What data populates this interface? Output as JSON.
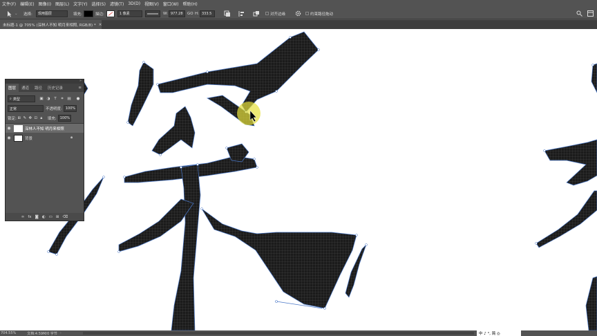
{
  "menu": [
    "文件(F)",
    "编辑(E)",
    "图像(I)",
    "图层(L)",
    "文字(Y)",
    "选择(S)",
    "滤镜(T)",
    "3D(D)",
    "视图(V)",
    "窗口(W)",
    "帮助(H)"
  ],
  "options": {
    "select_label": "选择:",
    "select_value": "现用图层",
    "fill_label": "填充:",
    "stroke_label": "描边:",
    "stroke_width": "1 像素",
    "w_label": "W:",
    "w_value": "977.28",
    "link_label": "GO",
    "h_label": "H:",
    "h_value": "333.5",
    "align_edges_label": "对齐边缘",
    "constrain_label": "约束路径拖动"
  },
  "document_tab": {
    "title": "未标题-1 @ 705% (深林人不知 明月来相照, RGB/8) *",
    "close": "×"
  },
  "layers_panel": {
    "tabs": [
      "图层",
      "通道",
      "路径",
      "历史记录"
    ],
    "kind_label": "类型",
    "blend_mode": "正常",
    "opacity_label": "不透明度:",
    "opacity_value": "100%",
    "lock_label": "锁定:",
    "fill_label": "填充:",
    "fill_value": "100%",
    "layers": [
      {
        "name": "深林人不知 明月来相照",
        "selected": true
      },
      {
        "name": "背景",
        "selected": false
      }
    ],
    "footer_icons": [
      "link-icon",
      "fx-icon",
      "mask-icon",
      "adjustment-icon",
      "folder-icon",
      "new-layer-icon",
      "trash-icon"
    ]
  },
  "status": {
    "zoom": "704.55%",
    "doc_info": "文档:4.59M/0 字节"
  },
  "ime": "中 ♪ °, 简 ◎",
  "colors": {
    "ui": "#535353",
    "dark": "#3d3d3d",
    "ink": "#1b1b1b",
    "path": "#4a78c8"
  }
}
